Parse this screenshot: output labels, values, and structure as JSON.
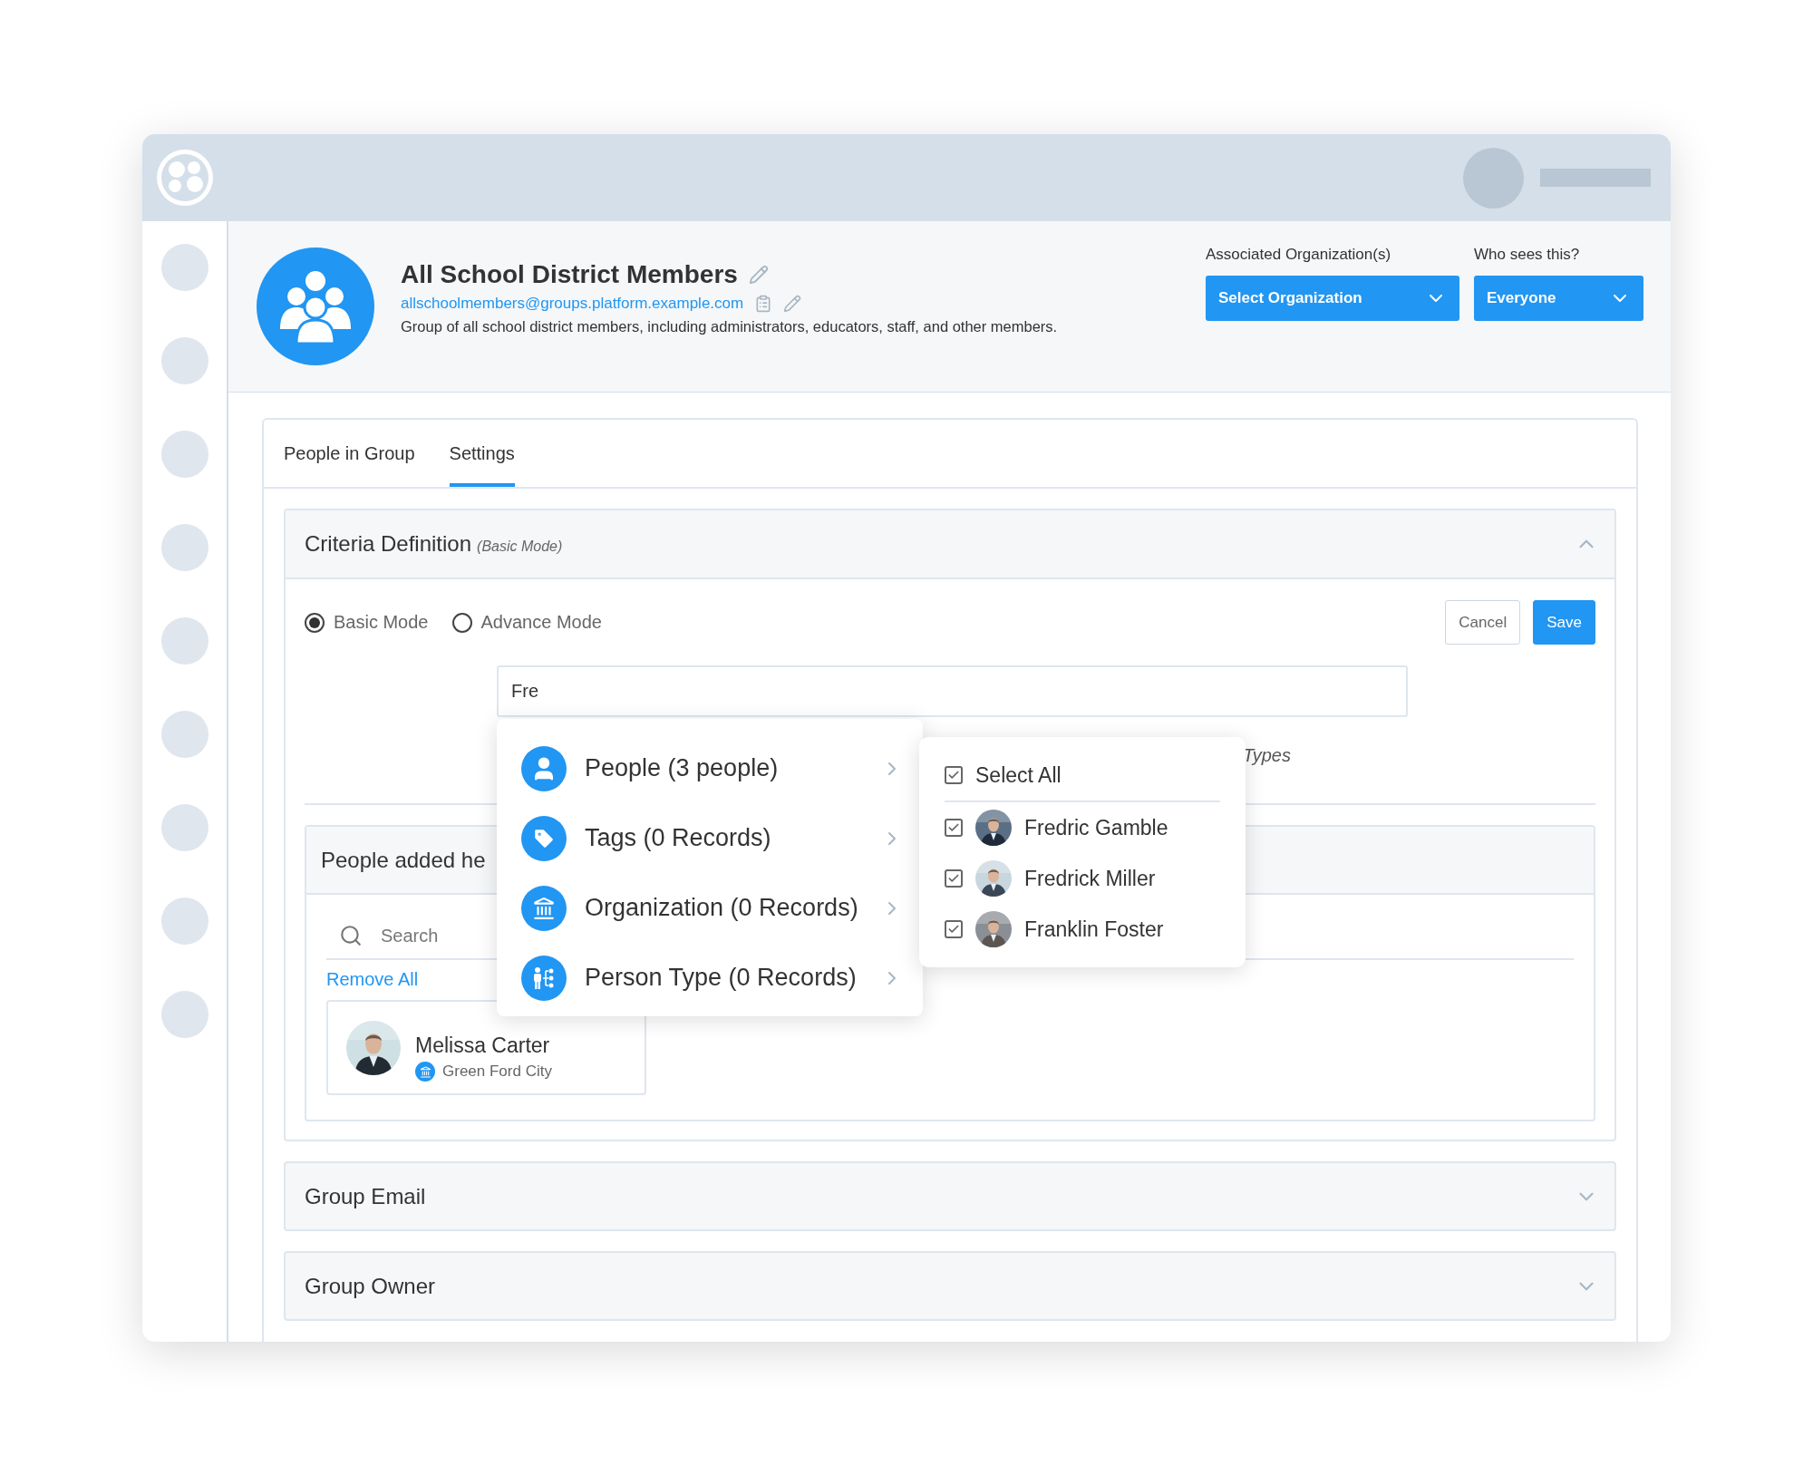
{
  "header": {
    "title": "All School District Members",
    "email": "allschoolmembers@groups.platform.example.com",
    "description": "Group of all school district members, including administrators, educators, staff, and other members.",
    "selects": [
      {
        "label": "Associated Organization(s)",
        "value": "Select Organization",
        "kind": "wide"
      },
      {
        "label": "Who sees this?",
        "value": "Everyone",
        "kind": "narrow"
      }
    ]
  },
  "tabs": [
    {
      "label": "People in Group",
      "selected": false
    },
    {
      "label": "Settings",
      "selected": true
    }
  ],
  "criteria": {
    "title": "Criteria Definition",
    "mode_note": "(Basic Mode)",
    "expanded": true,
    "modes": [
      {
        "label": "Basic Mode",
        "selected": true
      },
      {
        "label": "Advance Mode",
        "selected": false
      }
    ],
    "buttons": [
      {
        "label": "Cancel",
        "kind": "secondary"
      },
      {
        "label": "Save",
        "kind": "primary"
      }
    ],
    "search": {
      "value": "Fre"
    },
    "hint": "Types",
    "menu": [
      {
        "label": "People (3 people)",
        "kind": "people"
      },
      {
        "label": "Tags (0 Records)",
        "kind": "tag"
      },
      {
        "label": "Organization (0 Records)",
        "kind": "organization"
      },
      {
        "label": "Person Type (0 Records)",
        "kind": "person_type"
      }
    ],
    "submenu": {
      "select_all": {
        "label": "Select All",
        "checked": true
      },
      "people": [
        {
          "name": "Fredric Gamble",
          "checked": true
        },
        {
          "name": "Fredrick Miller",
          "checked": true
        },
        {
          "name": "Franklin Foster",
          "checked": true
        }
      ]
    },
    "people_panel": {
      "title": "People added he",
      "search_placeholder": "Search",
      "remove_all": "Remove All",
      "members": [
        {
          "name": "Melissa Carter",
          "org": "Green Ford City"
        }
      ]
    }
  },
  "sections": [
    {
      "title": "Group Email",
      "expanded": false
    },
    {
      "title": "Group Owner",
      "expanded": false
    }
  ]
}
